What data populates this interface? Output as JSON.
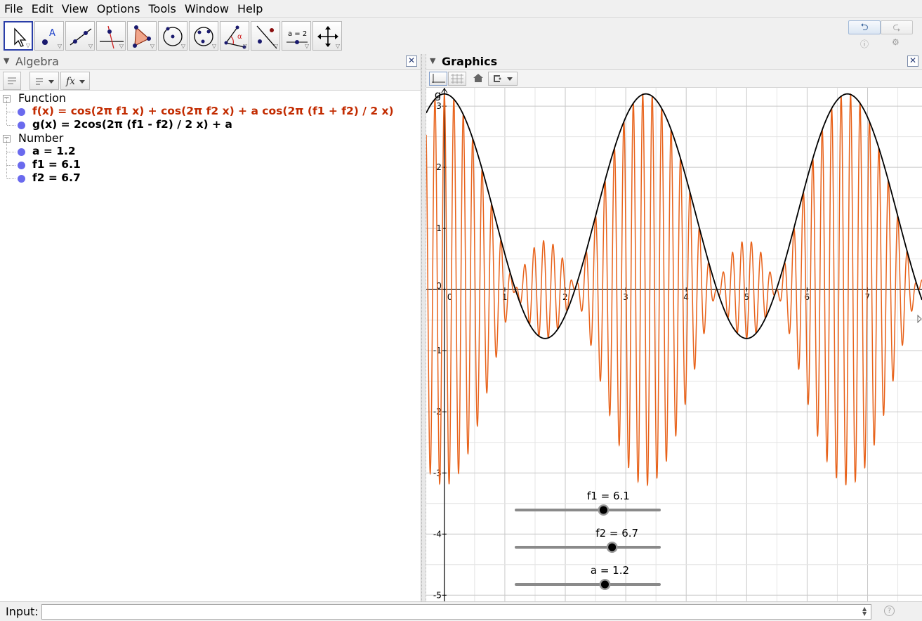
{
  "menu": [
    "File",
    "Edit",
    "View",
    "Options",
    "Tools",
    "Window",
    "Help"
  ],
  "toolbar": {
    "tools": [
      "move-tool",
      "point-tool",
      "line-tool",
      "perpendicular-line-tool",
      "polygon-tool",
      "circle-center-tool",
      "circle-three-points-tool",
      "angle-tool",
      "reflect-tool",
      "slider-tool",
      "move-graphics-view-tool"
    ],
    "slider_tool_label": "a = 2",
    "point_tool_label": "A",
    "angle_tool_label": "α",
    "undo_icon": "undo-icon",
    "redo_icon": "redo-icon",
    "help_icon": "help-icon",
    "settings_icon": "gear-icon"
  },
  "algebra": {
    "title": "Algebra",
    "categories": [
      {
        "label": "Function",
        "items": [
          {
            "text": "f(x) = cos(2π f1 x) + cos(2π f2 x) + a cos(2π (f1 + f2) / 2 x)",
            "color": "#c22b00"
          },
          {
            "text": "g(x) = 2cos(2π (f1 - f2) / 2 x) + a",
            "color": "#000000"
          }
        ]
      },
      {
        "label": "Number",
        "items": [
          {
            "text": "a = 1.2",
            "color": "#000000"
          },
          {
            "text": "f1 = 6.1",
            "color": "#000000"
          },
          {
            "text": "f2 = 6.7",
            "color": "#000000"
          }
        ]
      }
    ]
  },
  "graphics": {
    "title": "Graphics",
    "curve_label": "g",
    "f_color": "#e8621a",
    "g_color": "#000000",
    "sliders": [
      {
        "label": "f1 = 6.1",
        "value": 6.1,
        "min": 0,
        "max": 10
      },
      {
        "label": "f2 = 6.7",
        "value": 6.7,
        "min": 0,
        "max": 10
      },
      {
        "label": "a = 1.2",
        "value": 1.2,
        "min": -5,
        "max": 5
      }
    ]
  },
  "params": {
    "a": 1.2,
    "f1": 6.1,
    "f2": 6.7
  },
  "chart_data": {
    "type": "line",
    "series": [
      {
        "expression": "cos(2π f1 x) + cos(2π f2 x) + a cos(2π (f1 + f2) / 2 x)"
      },
      {
        "expression": "2cos(2π (f1 - f2) / 2 x) + a"
      }
    ],
    "x_ticks": [
      "0",
      "1",
      "2",
      "3",
      "4",
      "5",
      "6",
      "7"
    ],
    "y_ticks": [
      "3",
      "2",
      "1",
      "0",
      "-1",
      "-2",
      "-3",
      "-4",
      "-5"
    ],
    "xlim": [
      -0.3,
      7.9
    ],
    "ylim": [
      -5.1,
      3.3
    ],
    "grid": true
  },
  "input": {
    "label": "Input:",
    "value": ""
  }
}
